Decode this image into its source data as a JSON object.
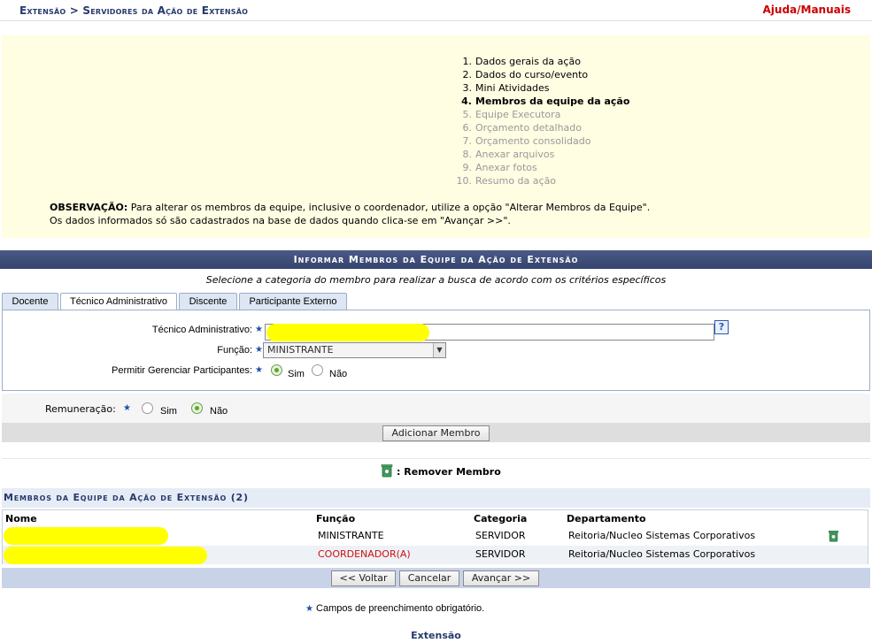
{
  "header": {
    "breadcrumb": "Extensão > Servidores da Ação de Extensão",
    "help_link": "Ajuda/Manuais"
  },
  "steps": [
    {
      "num": "1.",
      "label": "Dados gerais da ação",
      "state": "done"
    },
    {
      "num": "2.",
      "label": "Dados do curso/evento",
      "state": "done"
    },
    {
      "num": "3.",
      "label": "Mini Atividades",
      "state": "done"
    },
    {
      "num": "4.",
      "label": "Membros da equipe da ação",
      "state": "current"
    },
    {
      "num": "5.",
      "label": "Equipe Executora",
      "state": "disabled"
    },
    {
      "num": "6.",
      "label": "Orçamento detalhado",
      "state": "disabled"
    },
    {
      "num": "7.",
      "label": "Orçamento consolidado",
      "state": "disabled"
    },
    {
      "num": "8.",
      "label": "Anexar arquivos",
      "state": "disabled"
    },
    {
      "num": "9.",
      "label": "Anexar fotos",
      "state": "disabled"
    },
    {
      "num": "10.",
      "label": "Resumo da ação",
      "state": "disabled"
    }
  ],
  "observation": {
    "label": "OBSERVAÇÃO:",
    "line1": " Para alterar os membros da equipe, inclusive o coordenador, utilize a opção \"Alterar Membros da Equipe\".",
    "line2": "Os dados informados só são cadastrados na base de dados quando clica-se em \"Avançar >>\"."
  },
  "section": {
    "title": "Informar Membros da Equipe da Ação de Extensão",
    "hint": "Selecione a categoria do membro para realizar a busca de acordo com os critérios específicos"
  },
  "tabs": [
    {
      "label": "Docente"
    },
    {
      "label": "Técnico Administrativo"
    },
    {
      "label": "Discente"
    },
    {
      "label": "Participante Externo"
    }
  ],
  "form": {
    "tecnico_label": "Técnico Administrativo:",
    "tecnico_value": "",
    "help_button": "?",
    "funcao_label": "Função:",
    "funcao_value": "MINISTRANTE",
    "gerenciar_label": "Permitir Gerenciar Participantes:",
    "gerenciar_options": [
      "Sim",
      "Não"
    ],
    "gerenciar_selected": "Sim",
    "remuneracao_label": "Remuneração:",
    "remuneracao_options": [
      "Sim",
      "Não"
    ],
    "remuneracao_selected": "Não",
    "add_button": "Adicionar Membro",
    "required_star": "★"
  },
  "legend": {
    "remove": ": Remover Membro"
  },
  "members": {
    "title": "Membros da Equipe da Ação de Extensão (2)",
    "columns": [
      "Nome",
      "Função",
      "Categoria",
      "Departamento"
    ],
    "rows": [
      {
        "nome": "",
        "funcao": "MINISTRANTE",
        "categoria": "SERVIDOR",
        "departamento": "Reitoria/Nucleo Sistemas Corporativos",
        "funcao_color": "#000000",
        "removable": true
      },
      {
        "nome": "",
        "funcao": "COORDENADOR(A)",
        "categoria": "SERVIDOR",
        "departamento": "Reitoria/Nucleo Sistemas Corporativos",
        "funcao_color": "#cc1111",
        "removable": false
      }
    ]
  },
  "nav": {
    "back": "<< Voltar",
    "cancel": "Cancelar",
    "next": "Avançar >>"
  },
  "required_note": "Campos de preenchimento obrigatório.",
  "footer": "Extensão",
  "colors": {
    "title_bar": "#3f4f7a",
    "info_bg": "#fffde2",
    "highlight": "#ffff00"
  }
}
